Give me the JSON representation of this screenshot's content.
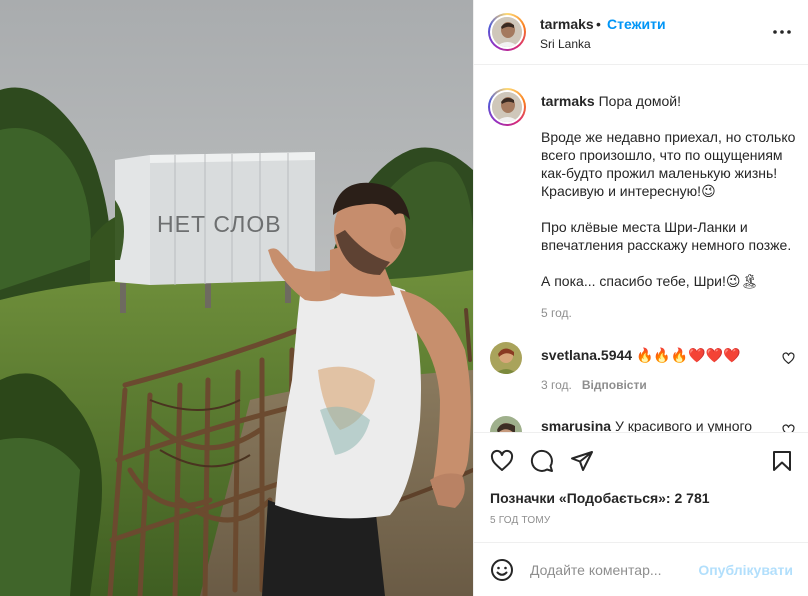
{
  "post": {
    "username": "tarmaks",
    "dot": "•",
    "follow_label": "Стежити",
    "location": "Sri Lanka",
    "more_icon": "more-horizontal-icon",
    "photo_sign_text": "НЕТ СЛОВ"
  },
  "caption": {
    "username": "tarmaks",
    "lead": "Пора домой!",
    "paragraphs": [
      "Вроде же недавно приехал, но столько всего произошло, что по ощущениям как-будто прожил маленькую жизнь! Красивую и интересную!😉",
      "Про клёвые места Шри-Ланки и впечатления расскажу немного позже.",
      "А пока... спасибо тебе, Шри!😉🏝"
    ],
    "time": "5 год."
  },
  "comments": [
    {
      "username": "svetlana.5944",
      "text": "🔥🔥🔥❤️❤️❤️",
      "time": "3 год.",
      "reply_label": "Відповісти"
    },
    {
      "username": "smarusina",
      "text": "У красивого и умного"
    }
  ],
  "actions": {
    "like_icon": "heart-icon",
    "comment_icon": "comment-icon",
    "share_icon": "send-icon",
    "save_icon": "bookmark-icon"
  },
  "likes": {
    "text": "Позначки «Подобається»: 2 781"
  },
  "timestamp": "5 год тому",
  "composer": {
    "placeholder": "Додайте коментар...",
    "post_label": "Опублікувати",
    "emoji_icon": "smile-icon"
  },
  "colors": {
    "accent": "#0095f6",
    "post_disabled": "#b2dffc",
    "muted": "#8e8e8e",
    "text": "#262626",
    "divider": "#efefef"
  }
}
